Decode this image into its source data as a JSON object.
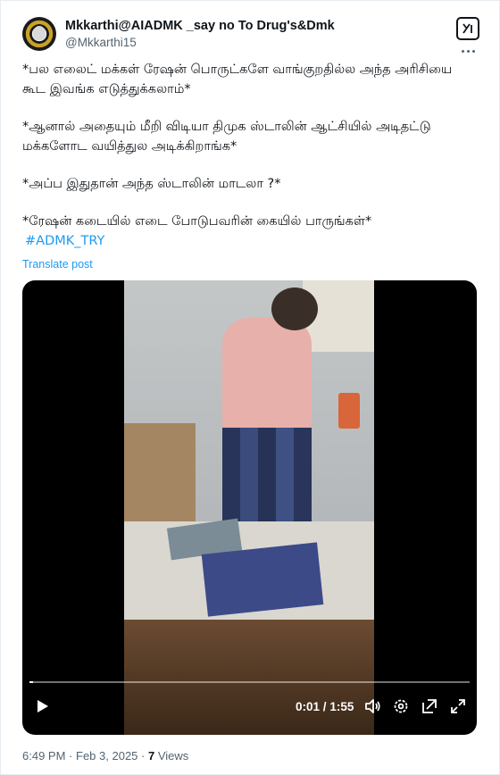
{
  "author": {
    "name": "Mkkarthi@AIADMK _say no To Drug's&Dmk",
    "handle": "@Mkkarthi15"
  },
  "post": {
    "paragraphs": [
      "*பல எலைட் மக்கள் ரேஷன் பொருட்களே வாங்குறதில்ல அந்த அரிசியை கூட இவங்க எடுத்துக்கலாம்*",
      "*ஆனால் அதையும் மீறி விடியா திமுக ஸ்டாலின் ஆட்சியில் அடிதட்டு மக்களோட வயித்துல அடிக்கிறாங்க*",
      "*அப்ப இதுதான் அந்த ஸ்டாலின் மாடலா ?*",
      "*ரேஷன் கடையில் எடை போடுபவரின் கையில் பாருங்கள்*"
    ],
    "hashtag": "#ADMK_TRY",
    "translate_label": "Translate post"
  },
  "video": {
    "current_time": "0:01",
    "separator": "/",
    "duration": "1:55",
    "progress": 0.009
  },
  "meta": {
    "time": "6:49 PM",
    "dot": "·",
    "date": "Feb 3, 2025",
    "views_count": "7",
    "views_label": "Views"
  },
  "colors": {
    "link": "#1d9bf0",
    "secondary_text": "#536471",
    "primary_text": "#0f1419"
  },
  "icons": [
    "grok-icon",
    "more-icon",
    "play-icon",
    "volume-icon",
    "settings-icon",
    "pip-icon",
    "fullscreen-icon"
  ]
}
